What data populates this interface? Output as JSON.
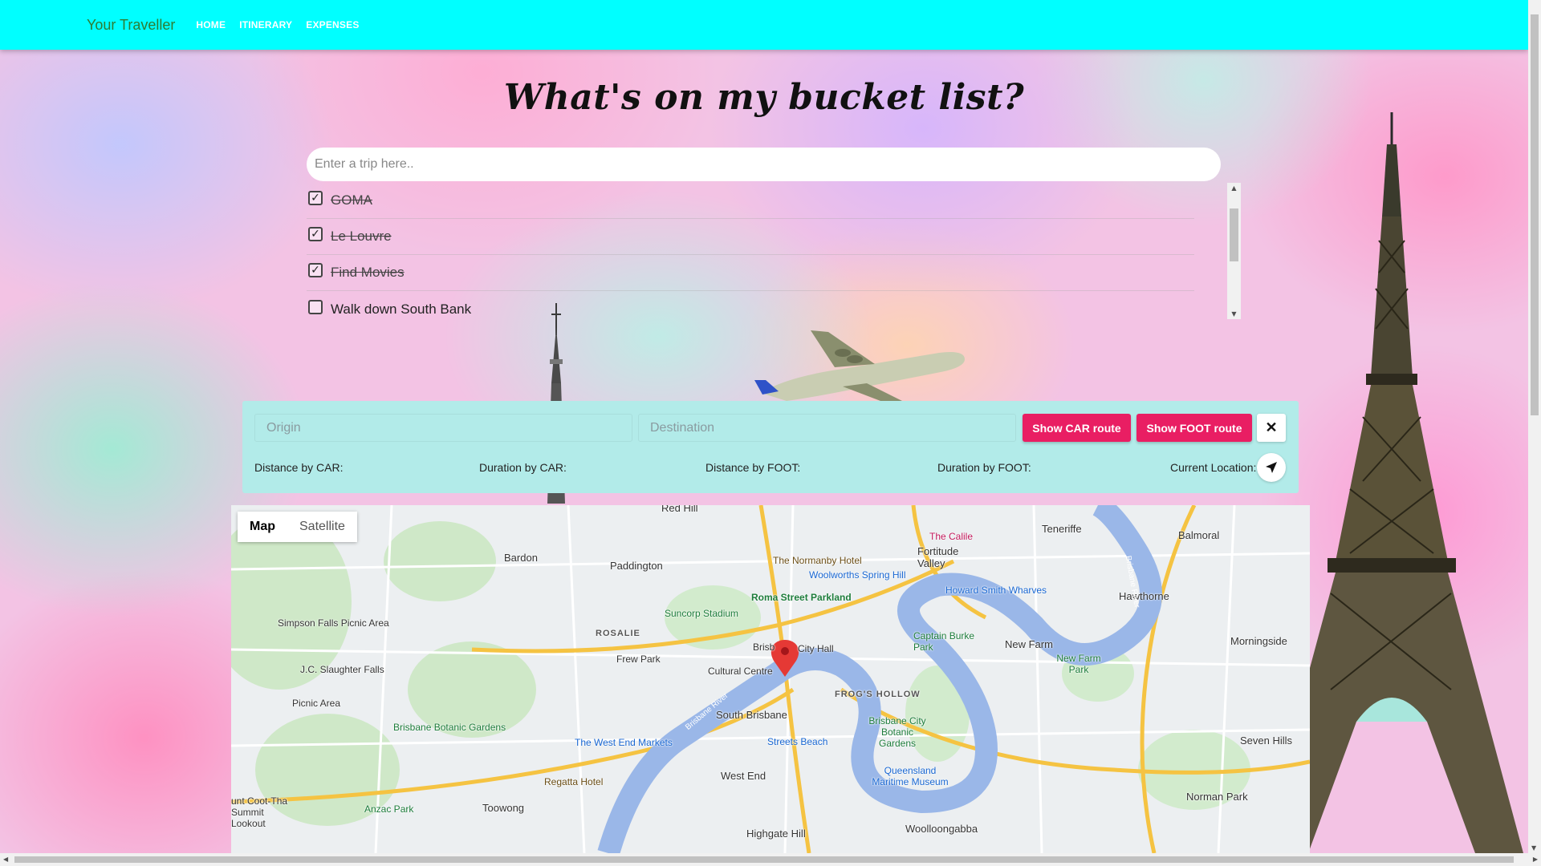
{
  "navbar": {
    "brand": "Your Traveller",
    "links": [
      "HOME",
      "ITINERARY",
      "EXPENSES"
    ]
  },
  "heading": "What's on my bucket list?",
  "trip_input": {
    "placeholder": "Enter a trip here..",
    "value": ""
  },
  "bucket_list": [
    {
      "label": "GOMA",
      "checked": true
    },
    {
      "label": "Le Louvre",
      "checked": true
    },
    {
      "label": "Find Movies",
      "checked": true
    },
    {
      "label": "Walk down South Bank",
      "checked": false
    }
  ],
  "route": {
    "origin_placeholder": "Origin",
    "destination_placeholder": "Destination",
    "car_button": "Show CAR route",
    "foot_button": "Show FOOT route",
    "close_icon": "close-icon",
    "distance_car": "Distance by CAR:",
    "duration_car": "Duration by CAR:",
    "distance_foot": "Distance by FOOT:",
    "duration_foot": "Duration by FOOT:",
    "current_location": "Current Location:",
    "location_icon": "navigation-arrow-icon"
  },
  "map": {
    "type_buttons": [
      "Map",
      "Satellite"
    ],
    "active_type": "Map",
    "labels": {
      "red_hill": "Red Hill",
      "teneriffe": "Teneriffe",
      "balmoral": "Balmoral",
      "bardon": "Bardon",
      "paddington": "Paddington",
      "normanby_hotel": "The Normanby Hotel",
      "woolworths": "Woolworths Spring Hill",
      "the_calile": "The Calile",
      "fortitude_valley": "Fortitude Valley",
      "howard_smith": "Howard Smith Wharves",
      "hawthorne": "Hawthorne",
      "roma_street": "Roma Street Parkland",
      "suncorp": "Suncorp Stadium",
      "simpson_falls": "Simpson Falls Picnic Area",
      "rosalie": "ROSALIE",
      "captain_burke": "Captain Burke Park",
      "new_farm": "New Farm",
      "new_farm_park": "New Farm Park",
      "morningside": "Morningside",
      "jc_slaughter": "J.C. Slaughter Falls",
      "frew_park": "Frew Park",
      "city_hall": "City Hall",
      "brisbane": "Brisb",
      "cultural_centre": "Cultural Centre",
      "frogs_hollow": "FROG'S HOLLOW",
      "picnic_area": "Picnic Area",
      "south_brisbane": "South Brisbane",
      "brisbane_city_botanic": "Brisbane City Botanic Gardens",
      "botanic_gardens": "Brisbane Botanic Gardens",
      "west_end_markets": "The West End Markets",
      "streets_beach": "Streets Beach",
      "seven_hills": "Seven Hills",
      "qld_maritime": "Queensland Maritime Museum",
      "regatta": "Regatta Hotel",
      "west_end": "West End",
      "mt_coot_tha": "unt Coot-Tha Summit Lookout",
      "anzac_park": "Anzac Park",
      "toowong": "Toowong",
      "norman_park": "Norman Park",
      "highgate_hill": "Highgate Hill",
      "woolloongabba": "Woolloongabba",
      "brisbane_river": "Brisbane River"
    }
  },
  "colors": {
    "navbar": "#00ffff",
    "brand": "#2e7d32",
    "panel": "#b2ebe9",
    "accent": "#e91e63"
  }
}
